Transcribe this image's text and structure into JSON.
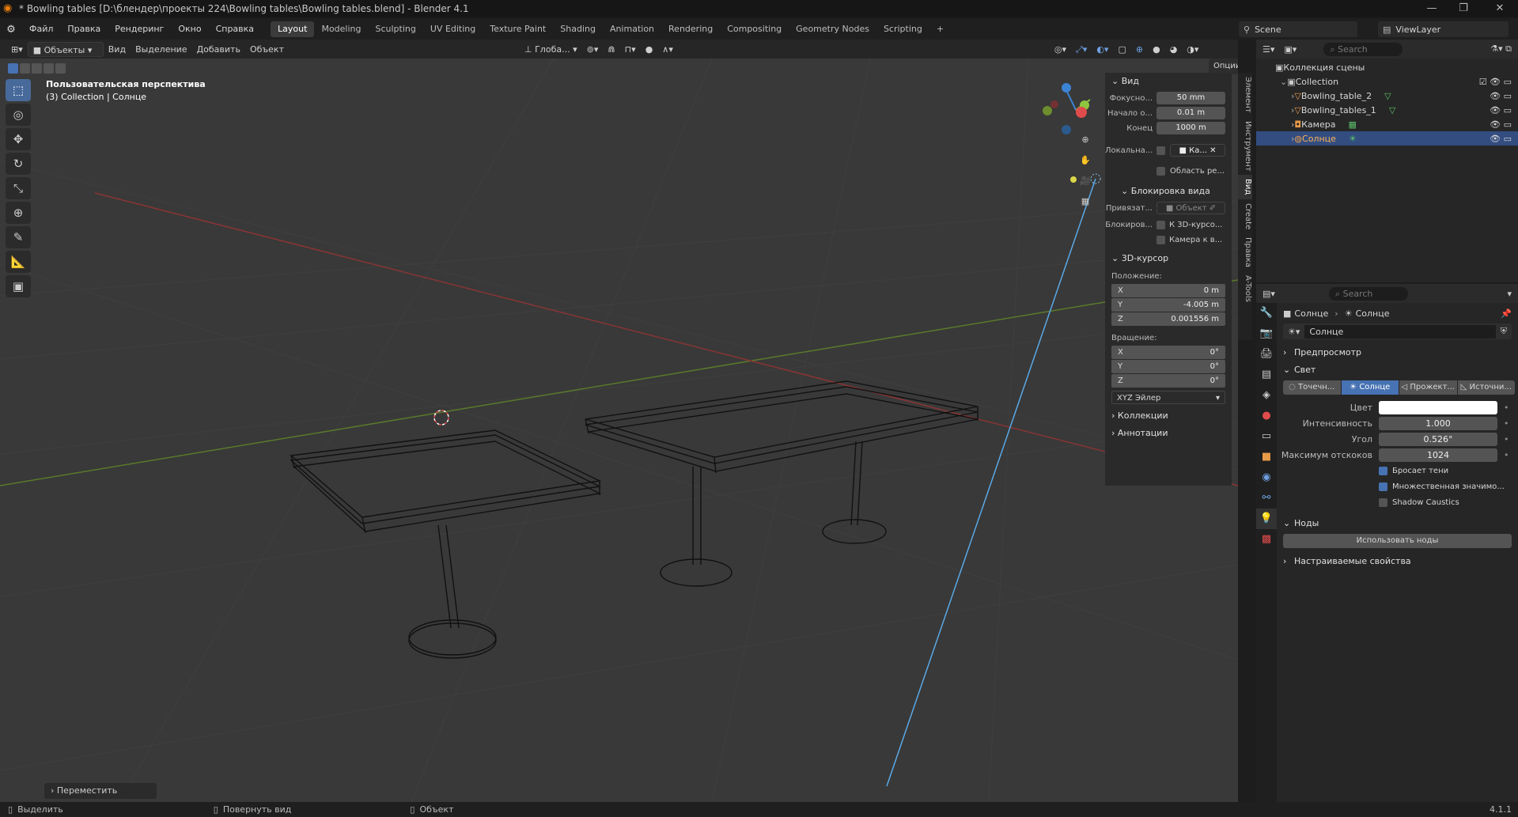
{
  "window": {
    "title": "* Bowling tables [D:\\блендер\\проекты 224\\Bowling tables\\Bowling tables.blend] - Blender 4.1",
    "minimize_icon": "minimize-icon",
    "maximize_icon": "maximize-icon",
    "close_icon": "close-icon"
  },
  "menu": {
    "items": [
      "Файл",
      "Правка",
      "Рендеринг",
      "Окно",
      "Справка"
    ]
  },
  "workspaces": [
    "Layout",
    "Modeling",
    "Sculpting",
    "UV Editing",
    "Texture Paint",
    "Shading",
    "Animation",
    "Rendering",
    "Compositing",
    "Geometry Nodes",
    "Scripting"
  ],
  "active_workspace": "Layout",
  "add_workspace": "+",
  "scene": {
    "label": "Scene",
    "viewlayer": "ViewLayer"
  },
  "header": {
    "mode": "Объекты",
    "menus": [
      "Вид",
      "Выделение",
      "Добавить",
      "Объект"
    ],
    "orientation": "Глоба...",
    "options": "Опции"
  },
  "viewport": {
    "perspective": "Пользовательская перспектива",
    "collection_info": "(3) Collection | Солнце",
    "last_op": "Переместить"
  },
  "npanel": {
    "tabs": [
      "Элемент",
      "Инструмент",
      "Вид",
      "Create",
      "Правка",
      "A-Tools"
    ],
    "view_header": "Вид",
    "focal_label": "Фокусно...",
    "focal_value": "50 mm",
    "clip_start_label": "Начало о...",
    "clip_start_value": "0.01 m",
    "clip_end_label": "Конец",
    "clip_end_value": "1000 m",
    "local_label": "Локальна...",
    "local_camera": "Ка...",
    "render_region": "Область ре...",
    "lock_header": "Блокировка вида",
    "lock_to_label": "Привязат...",
    "lock_to_value": "Объект",
    "lock_label": "Блокиров...",
    "lock_cursor": "К 3D-курсо...",
    "lock_camera": "Камера к в...",
    "cursor_header": "3D-курсор",
    "location_label": "Положение:",
    "loc_x_key": "X",
    "loc_x": "0 m",
    "loc_y_key": "Y",
    "loc_y": "-4.005 m",
    "loc_z_key": "Z",
    "loc_z": "0.001556 m",
    "rotation_label": "Вращение:",
    "rot_x_key": "X",
    "rot_x": "0°",
    "rot_y_key": "Y",
    "rot_y": "0°",
    "rot_z_key": "Z",
    "rot_z": "0°",
    "rot_mode": "XYZ Эйлер",
    "collections_header": "Коллекции",
    "annotations_header": "Аннотации"
  },
  "outliner": {
    "search_placeholder": "Search",
    "root": "Коллекция сцены",
    "collection": "Collection",
    "items": [
      "Bowling_table_2",
      "Bowling_tables_1",
      "Камера",
      "Солнце"
    ]
  },
  "properties": {
    "search_placeholder": "Search",
    "breadcrumb_object": "Солнце",
    "breadcrumb_data": "Солнце",
    "datablock": "Солнце",
    "preview_header": "Предпросмотр",
    "light_header": "Свет",
    "light_types": [
      "Точечн...",
      "Солнце",
      "Прожект...",
      "Источни..."
    ],
    "active_light_type": "Солнце",
    "color_label": "Цвет",
    "color_value": "#ffffff",
    "strength_label": "Интенсивность",
    "strength_value": "1.000",
    "angle_label": "Угол",
    "angle_value": "0.526°",
    "max_bounces_label": "Максимум отскоков",
    "max_bounces_value": "1024",
    "cast_shadow": "Бросает тени",
    "multiple_importance": "Множественная значимо...",
    "shadow_caustics": "Shadow Caustics",
    "nodes_header": "Ноды",
    "use_nodes": "Использовать ноды",
    "custom_props": "Настраиваемые свойства"
  },
  "status": {
    "select": "Выделить",
    "rotate": "Повернуть вид",
    "object": "Объект",
    "version": "4.1.1"
  },
  "colors": {
    "accent": "#4772b3",
    "selected_row": "#334d80",
    "grid_x": "#8a3434",
    "grid_y": "#5a7a2a",
    "light_line": "#5aa9e6"
  }
}
